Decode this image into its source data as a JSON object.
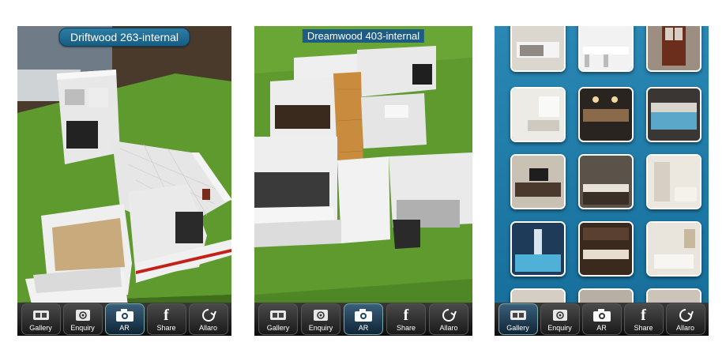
{
  "screens": [
    {
      "title": "Driftwood 263-internal",
      "tabs": [
        {
          "label": "Gallery",
          "icon": "film-icon",
          "active": false
        },
        {
          "label": "Enquiry",
          "icon": "at-icon",
          "active": false
        },
        {
          "label": "AR",
          "icon": "camera-icon",
          "active": true
        },
        {
          "label": "Share",
          "icon": "facebook-icon",
          "active": false
        },
        {
          "label": "Allaro",
          "icon": "allaro-icon",
          "active": false
        }
      ]
    },
    {
      "title": "Dreamwood 403-internal",
      "tabs": [
        {
          "label": "Gallery",
          "icon": "film-icon",
          "active": false
        },
        {
          "label": "Enquiry",
          "icon": "at-icon",
          "active": false
        },
        {
          "label": "AR",
          "icon": "camera-icon",
          "active": true
        },
        {
          "label": "Share",
          "icon": "facebook-icon",
          "active": false
        },
        {
          "label": "Allaro",
          "icon": "allaro-icon",
          "active": false
        }
      ]
    },
    {
      "tabs": [
        {
          "label": "Gallery",
          "icon": "film-icon",
          "active": true
        },
        {
          "label": "Enquiry",
          "icon": "at-icon",
          "active": false
        },
        {
          "label": "AR",
          "icon": "camera-icon",
          "active": false
        },
        {
          "label": "Share",
          "icon": "facebook-icon",
          "active": false
        },
        {
          "label": "Allaro",
          "icon": "allaro-icon",
          "active": false
        }
      ],
      "gallery": [
        "bathroom-vanity",
        "kitchen-island",
        "wooden-front-door",
        "bedroom",
        "dining-room-night",
        "alfresco-pool",
        "living-tv-room",
        "kitchen-benchtop",
        "hallway-kitchen",
        "pool-fountain",
        "dark-kitchen",
        "bathroom-bath",
        "bedroom-2",
        "kitchen-2",
        "outdoor-2"
      ]
    }
  ],
  "colors": {
    "grass": "#5f9a2f",
    "floor_tile": "#e6e6e6",
    "timber": "#c98c3e",
    "wall": "#f2f2f2",
    "gallery_bg": "#2283b0",
    "tab_active": "#1a4560"
  }
}
